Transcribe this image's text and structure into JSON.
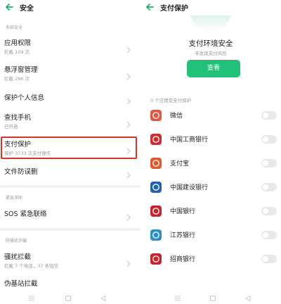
{
  "left": {
    "title": "安全",
    "sections": [
      "系统安全",
      "紧急求助",
      "防骚扰诈骗"
    ],
    "rows": [
      {
        "label": "应用权限",
        "sub": "拦截 109 次"
      },
      {
        "label": "悬浮窗管理",
        "sub": "拦截 296 次"
      },
      {
        "label": "保护个人信息",
        "sub": ""
      },
      {
        "label": "查找手机",
        "sub": "已开启"
      },
      {
        "label": "支付保护",
        "sub": "保护 3733 次支付操作"
      },
      {
        "label": "文件防误删",
        "sub": ""
      },
      {
        "label": "SOS 紧急联络",
        "sub": ""
      },
      {
        "label": "骚扰拦截",
        "sub": "拦截 7 个电话，37 条短信"
      },
      {
        "label": "伪基站拦截",
        "sub": ""
      }
    ]
  },
  "right": {
    "title": "支付保护",
    "hero_title": "支付环境安全",
    "hero_sub": "未发现支付风险",
    "check_button": "查看",
    "list_header": "0 个应用受支付保护",
    "apps": [
      {
        "name": "微信",
        "icon": "wechat-icon",
        "color": "#e5553f"
      },
      {
        "name": "中国工商银行",
        "icon": "icbc-icon",
        "color": "#d3282d"
      },
      {
        "name": "支付宝",
        "icon": "alipay-icon",
        "color": "#e4572e"
      },
      {
        "name": "中国建设银行",
        "icon": "ccb-icon",
        "color": "#1f61b6"
      },
      {
        "name": "中国银行",
        "icon": "boc-icon",
        "color": "#c8232c"
      },
      {
        "name": "江苏银行",
        "icon": "jsbank-icon",
        "color": "#2a8fd0"
      },
      {
        "name": "招商银行",
        "icon": "cmb-icon",
        "color": "#d11f26"
      }
    ]
  },
  "colors": {
    "accent": "#22c17a",
    "highlight": "#d83425"
  }
}
